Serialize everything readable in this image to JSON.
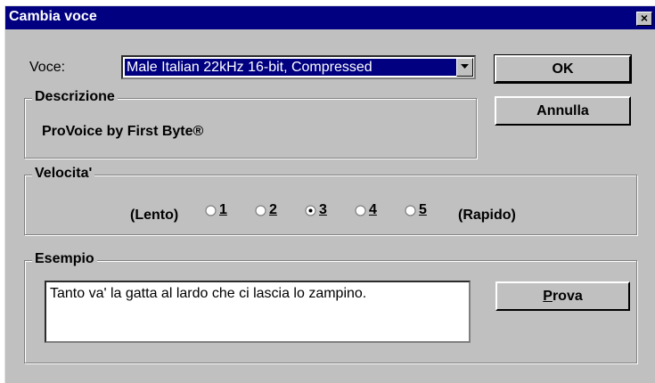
{
  "dialog": {
    "title": "Cambia voce",
    "close_glyph": "×"
  },
  "voice": {
    "label": "Voce:",
    "selected": "Male Italian 22kHz 16-bit, Compressed",
    "dropdown_icon": "chevron-down-icon"
  },
  "description": {
    "legend": "Descrizione",
    "text": "ProVoice by First Byte®"
  },
  "speed": {
    "legend": "Velocita'",
    "slow_label": "(Lento)",
    "fast_label": "(Rapido)",
    "options": [
      "1",
      "2",
      "3",
      "4",
      "5"
    ],
    "selected": "3"
  },
  "example": {
    "legend": "Esempio",
    "text": "Tanto va' la gatta al lardo che ci lascia lo zampino.",
    "test_button": "Prova"
  },
  "buttons": {
    "ok": "OK",
    "cancel": "Annulla"
  },
  "colors": {
    "face": "#c0c0c0",
    "title_bar": "#000080",
    "selection": "#000080"
  }
}
